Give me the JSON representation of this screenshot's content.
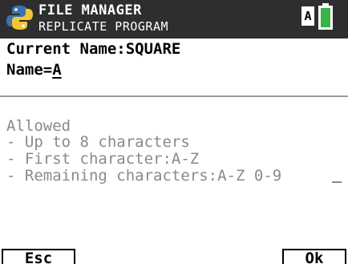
{
  "header": {
    "title": "FILE MANAGER",
    "subtitle": "REPLICATE PROGRAM",
    "mode_indicator": "A",
    "logo_icon": "python-logo-icon",
    "battery_icon": "battery-icon"
  },
  "main": {
    "current_name": "Current Name:SQUARE",
    "name_label": "Name=",
    "name_value": "A"
  },
  "help": {
    "lines": [
      "Allowed",
      "- Up to 8 characters",
      "- First character:A-Z",
      "- Remaining characters:A-Z 0-9"
    ]
  },
  "softkeys": {
    "left_label": "Esc",
    "right_label": "Ok"
  },
  "colors": {
    "header_bg": "#2e2e2e",
    "help_text": "#8a8a8a",
    "logo_blue": "#3a74b0",
    "logo_yellow": "#f2c633",
    "battery_green": "#36b54a"
  }
}
